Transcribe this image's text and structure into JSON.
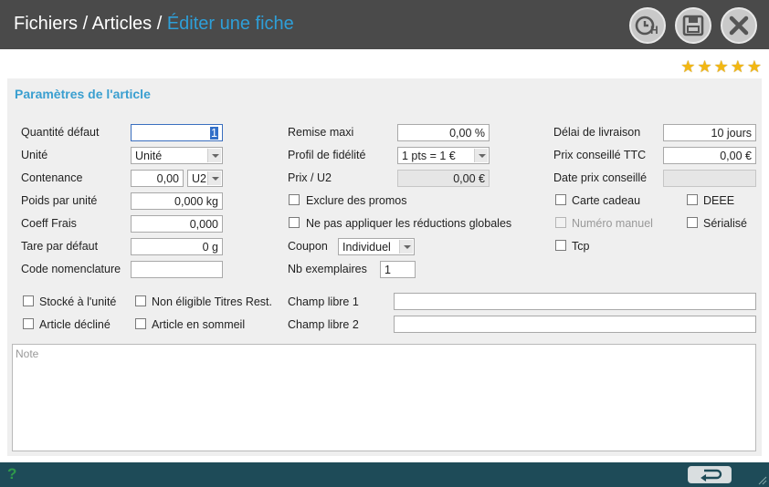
{
  "header": {
    "breadcrumb_part1": "Fichiers / Articles / ",
    "breadcrumb_part2": "Éditer une fiche",
    "buttons": [
      "clock-h-icon",
      "save-icon",
      "close-icon"
    ]
  },
  "rating": {
    "stars": 5,
    "color": "#f2b713"
  },
  "section": {
    "title": "Paramètres de l'article"
  },
  "col1": {
    "quantite_label": "Quantité défaut",
    "quantite_value": "1",
    "unite_label": "Unité",
    "unite_value": "Unité",
    "contenance_label": "Contenance",
    "contenance_value": "0,00",
    "contenance_unit": "U2",
    "poids_label": "Poids par unité",
    "poids_value": "0,000 kg",
    "coeff_label": "Coeff Frais",
    "coeff_value": "0,000",
    "tare_label": "Tare par défaut",
    "tare_value": "0 g",
    "code_label": "Code nomenclature",
    "code_value": ""
  },
  "col2": {
    "remise_label": "Remise maxi",
    "remise_value": "0,00 %",
    "profil_label": "Profil de fidélité",
    "profil_value": "1 pts = 1 €",
    "prix_u2_label": "Prix / U2",
    "prix_u2_value": "0,00 €",
    "exclure_label": "Exclure des promos",
    "reductions_label": "Ne pas appliquer les réductions globales",
    "coupon_label": "Coupon",
    "coupon_value": "Individuel",
    "nb_label": "Nb exemplaires",
    "nb_value": "1"
  },
  "col3": {
    "delai_label": "Délai de livraison",
    "delai_value": "10 jours",
    "prix_ttc_label": "Prix conseillé TTC",
    "prix_ttc_value": "0,00 €",
    "date_prix_label": "Date prix conseillé",
    "date_prix_value": "",
    "carte_label": "Carte cadeau",
    "deee_label": "DEEE",
    "numero_label": "Numéro manuel",
    "serialise_label": "Sérialisé",
    "tcp_label": "Tcp"
  },
  "bottom": {
    "stocke_label": "Stocké à l'unité",
    "non_eligible_label": "Non éligible Titres Rest.",
    "decline_label": "Article décliné",
    "sommeil_label": "Article en sommeil",
    "champ1_label": "Champ libre 1",
    "champ1_value": "",
    "champ2_label": "Champ libre 2",
    "champ2_value": "",
    "note_placeholder": "Note"
  },
  "footer": {
    "help": "?",
    "back_icon": "return-arrow-icon"
  },
  "colors": {
    "accent": "#2e9fd8",
    "title_bar": "#4a4a4a",
    "footer": "#1e4b58"
  }
}
